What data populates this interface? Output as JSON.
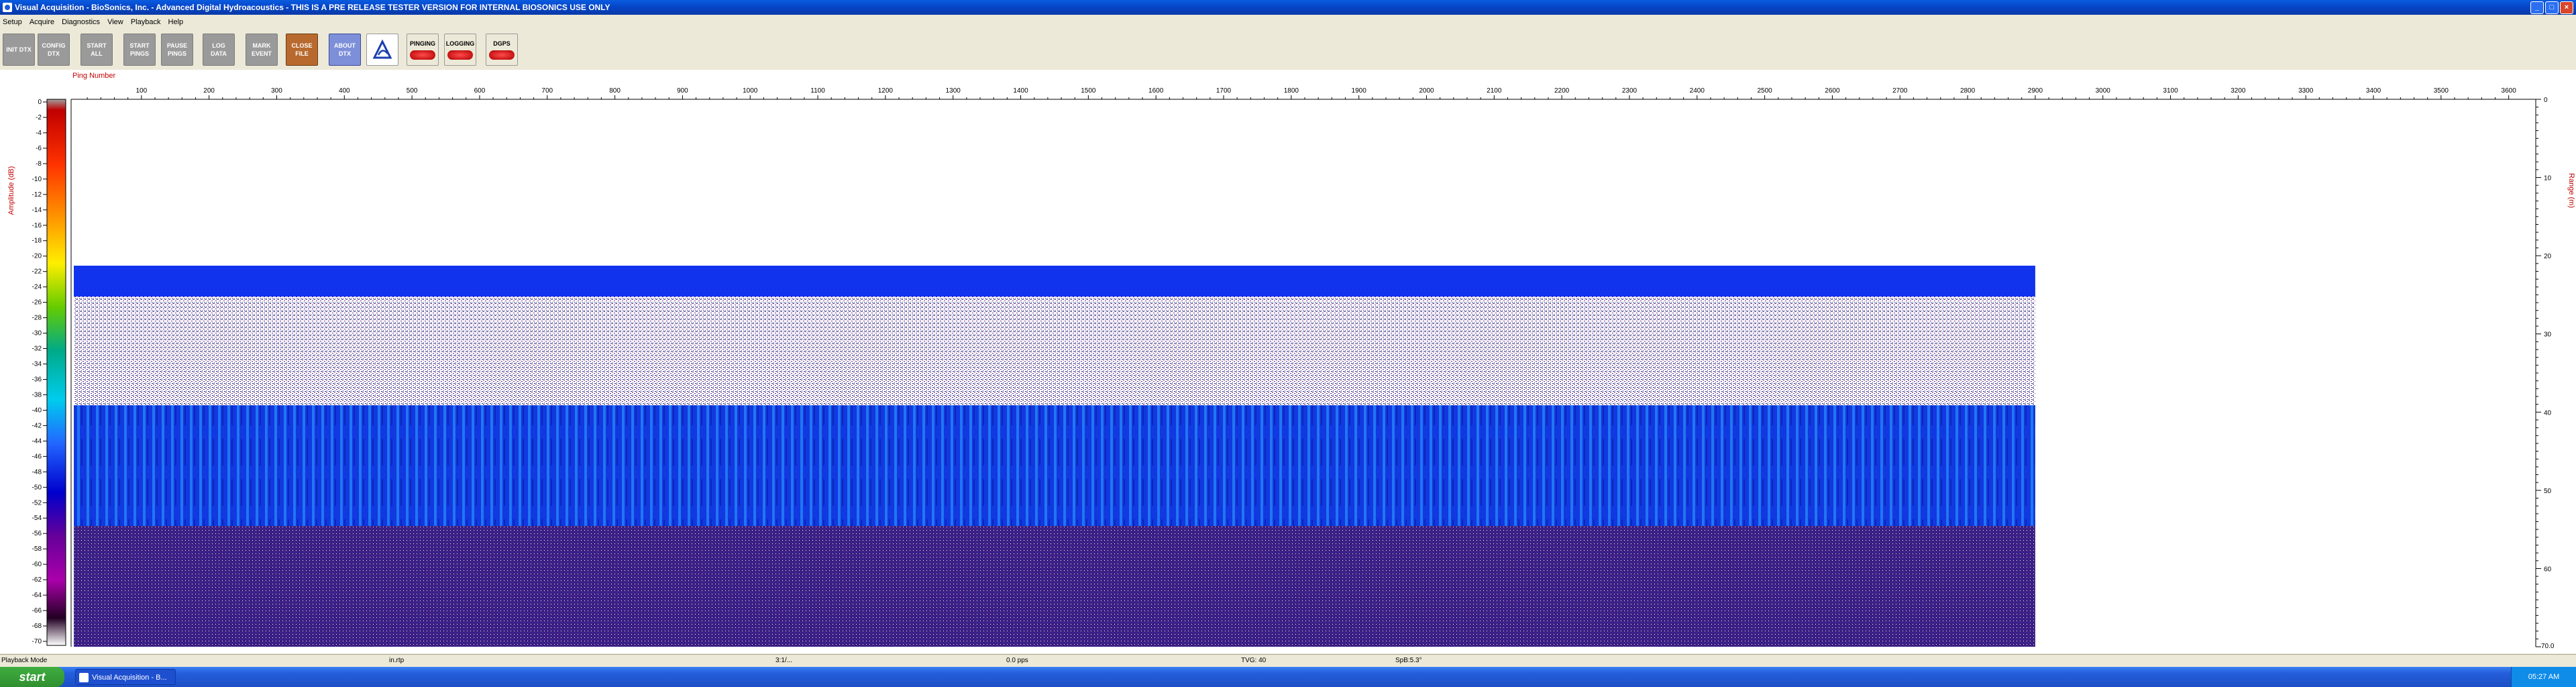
{
  "window": {
    "title": "Visual Acquisition  -  BioSonics, Inc.  -  Advanced Digital Hydroacoustics  -  THIS IS A PRE RELEASE TESTER VERSION FOR INTERNAL BIOSONICS USE ONLY"
  },
  "menu": [
    "Setup",
    "Acquire",
    "Diagnostics",
    "View",
    "Playback",
    "Help"
  ],
  "toolbar": {
    "buttons": [
      {
        "label": "INIT DTX",
        "style": "gray"
      },
      {
        "label": "CONFIG DTX",
        "style": "gray"
      },
      {
        "label": "START ALL",
        "style": "gray"
      },
      {
        "label": "START PINGS",
        "style": "gray"
      },
      {
        "label": "PAUSE PINGS",
        "style": "gray"
      },
      {
        "label": "LOG DATA",
        "style": "gray"
      },
      {
        "label": "MARK EVENT",
        "style": "gray"
      },
      {
        "label": "CLOSE FILE",
        "style": "brown"
      },
      {
        "label": "ABOUT DTX",
        "style": "blue"
      }
    ],
    "indicators": [
      "PINGING",
      "LOGGING",
      "DGPS"
    ]
  },
  "echogram": {
    "x_axis_label": "Ping Number",
    "x_ticks": [
      100,
      200,
      300,
      400,
      500,
      600,
      700,
      800,
      900,
      1000,
      1100,
      1200,
      1300,
      1400,
      1500,
      1600,
      1700,
      1800,
      1900,
      2000,
      2100,
      2200,
      2300,
      2400,
      2500,
      2600,
      2700,
      2800,
      2900,
      3000,
      3100,
      3200,
      3300,
      3400,
      3500,
      3600
    ],
    "ping_range": [
      0,
      3640
    ],
    "pings_recorded": 2900,
    "colorbar_label": "Amplitude (dB)",
    "colorbar_ticks": [
      0,
      -2,
      -4,
      -6,
      -8,
      -10,
      -12,
      -14,
      -16,
      -18,
      -20,
      -22,
      -24,
      -26,
      -28,
      -30,
      -32,
      -34,
      -36,
      -38,
      -40,
      -42,
      -44,
      -46,
      -48,
      -50,
      -52,
      -54,
      -56,
      -58,
      -60,
      -62,
      -64,
      -66,
      -68,
      -70
    ],
    "colorbar_range": [
      0,
      -70
    ],
    "range_label": "Range (m)",
    "range_ticks": [
      0,
      10,
      20,
      30,
      40,
      50,
      60,
      70
    ],
    "range_max_label": "70.0",
    "range_max": 70,
    "colors": {
      "surface_band": "#1133ee",
      "noise_band": "#5a1a7a",
      "lower_band": "#1040e0",
      "deep_band": "#2a1a6a"
    }
  },
  "statusbar": {
    "mode": "Playback Mode",
    "file": "in.rtp",
    "time": "3:1/...",
    "ping_rate": "0.0 pps",
    "tvg": "TVG: 40",
    "spb": "SpB:5.3°"
  },
  "taskbar": {
    "start": "start",
    "item": "Visual Acquisition - B...",
    "clock": "05:27 AM"
  }
}
